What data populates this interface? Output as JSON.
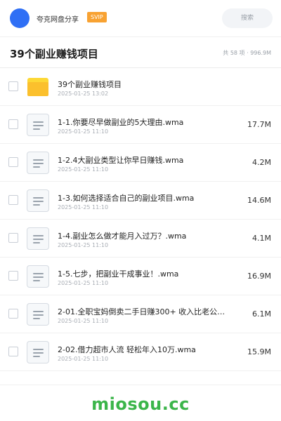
{
  "header": {
    "user_name": "夸克网盘分享",
    "badge": "SVIP",
    "search_placeholder": "搜索",
    "avatar_color": "#2f6ff5"
  },
  "folder": {
    "title": "39个副业赚钱项目",
    "summary": "共 58 项 · 996.9M"
  },
  "items": [
    {
      "type": "folder",
      "name": "39个副业赚钱项目",
      "date": "2025-01-25 13:02",
      "size": ""
    },
    {
      "type": "file",
      "name": "1-1.你要尽早做副业的5大理由.wma",
      "date": "2025-01-25 11:10",
      "size": "17.7M"
    },
    {
      "type": "file",
      "name": "1-2.4大副业类型让你早日赚钱.wma",
      "date": "2025-01-25 11:10",
      "size": "4.2M"
    },
    {
      "type": "file",
      "name": "1-3.如何选择适合自己的副业项目.wma",
      "date": "2025-01-25 11:10",
      "size": "14.6M"
    },
    {
      "type": "file",
      "name": "1-4.副业怎么做才能月入过万？.wma",
      "date": "2025-01-25 11:10",
      "size": "4.1M"
    },
    {
      "type": "file",
      "name": "1-5.七步，把副业干成事业！.wma",
      "date": "2025-01-25 11:10",
      "size": "16.9M"
    },
    {
      "type": "file",
      "name": "2-01.全职宝妈倒卖二手日赚300+ 收入比老公…",
      "date": "2025-01-25 11:10",
      "size": "6.1M"
    },
    {
      "type": "file",
      "name": "2-02.借力超市人流 轻松年入10万.wma",
      "date": "2025-01-25 11:10",
      "size": "15.9M"
    }
  ],
  "watermark": "miosou.cc",
  "colors": {
    "accent": "#2f6ff5",
    "badge": "#f8a232",
    "folder": "#fbc02d",
    "watermark": "#3bb54a"
  }
}
